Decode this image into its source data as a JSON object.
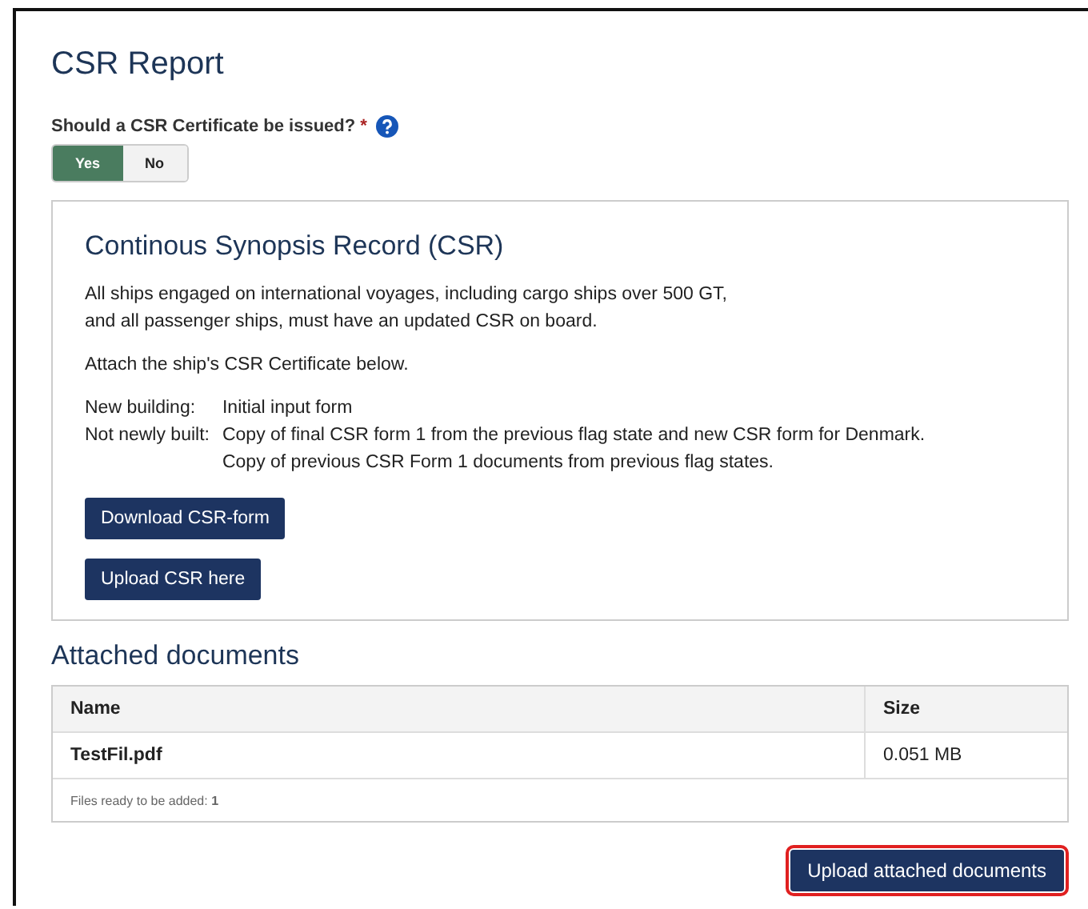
{
  "title": "CSR Report",
  "question": {
    "label": "Should a CSR Certificate be issued?",
    "required_mark": "*",
    "options": [
      {
        "label": "Yes",
        "selected": true
      },
      {
        "label": "No",
        "selected": false
      }
    ]
  },
  "info_card": {
    "heading": "Continous Synopsis Record (CSR)",
    "paragraphs": [
      "All ships engaged on international voyages, including cargo ships over 500 GT,\nand all passenger ships, must have an updated CSR on board.",
      "Attach the ship's CSR Certificate below."
    ],
    "requirements": [
      {
        "label": "New building:",
        "lines": [
          "Initial input form"
        ]
      },
      {
        "label": "Not newly built:",
        "lines": [
          "Copy of final CSR form 1 from the previous flag state and new CSR form for Denmark.",
          "Copy of previous CSR Form 1 documents from previous flag states."
        ]
      }
    ],
    "buttons": [
      "Download CSR-form",
      "Upload CSR here"
    ]
  },
  "attached": {
    "heading": "Attached documents",
    "columns": [
      "Name",
      "Size"
    ],
    "rows": [
      {
        "name": "TestFil.pdf",
        "size": "0.051 MB"
      }
    ],
    "footer": "Files ready to be added: **1**"
  },
  "upload_button": {
    "label": "Upload attached documents",
    "focused": true
  }
}
